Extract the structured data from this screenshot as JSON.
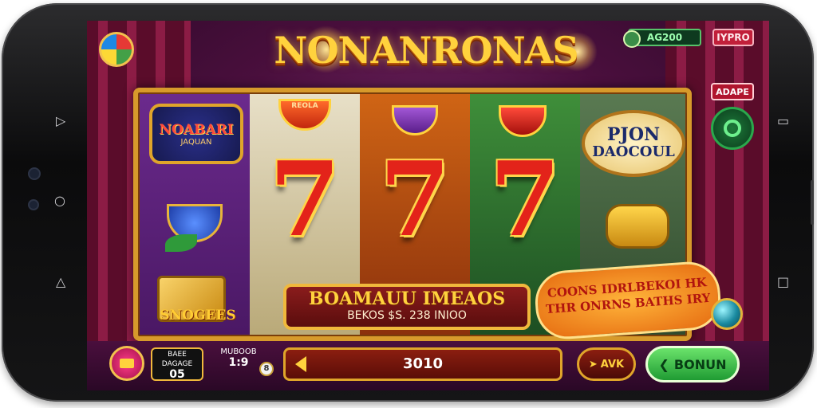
{
  "game": {
    "title": "NONANRONAS",
    "top_coins": "AG200",
    "top_level": "IYPRO",
    "side_badge": "ADAPE"
  },
  "reels": {
    "symbol_left_emblem": "NOABARI",
    "symbol_left_emblem_sub": "JAQUAN",
    "symbol_bowl_label": "REOLA",
    "symbol_bottom_label": "SNOGEES",
    "seven_glyph": "7",
    "emblem_right_line1": "PJON",
    "emblem_right_line2": "DAOCOUL"
  },
  "banner": {
    "title": "BOAMAUU IMEAOS",
    "subtitle": "BEKOS  $S. 238 INIOO"
  },
  "promo": {
    "line1": "COONS IDRLBEKOI HK",
    "line2": "THR ONRNS BATHS IRY"
  },
  "controls": {
    "bet_label": "BAEE",
    "bet_sublabel": "DAGAGE",
    "bet_value": "05",
    "lines_label": "MUBOOB",
    "lines_value": "1:9",
    "info_glyph": "8",
    "win_value": "3010",
    "auto_label": "AVK",
    "spin_label": "BONUN"
  },
  "colors": {
    "accent_gold": "#ffd23d",
    "spin_green": "#1f9b33",
    "frame_gold": "#d79a2b"
  },
  "icons": {
    "wheel": "fortune-wheel-icon",
    "share": "share-icon",
    "menu": "menu-icon",
    "auto": "auto-arrow-icon",
    "spin": "chevron-left-icon",
    "nav_back": "back-icon",
    "nav_home": "home-icon",
    "nav_recents": "recents-icon"
  }
}
